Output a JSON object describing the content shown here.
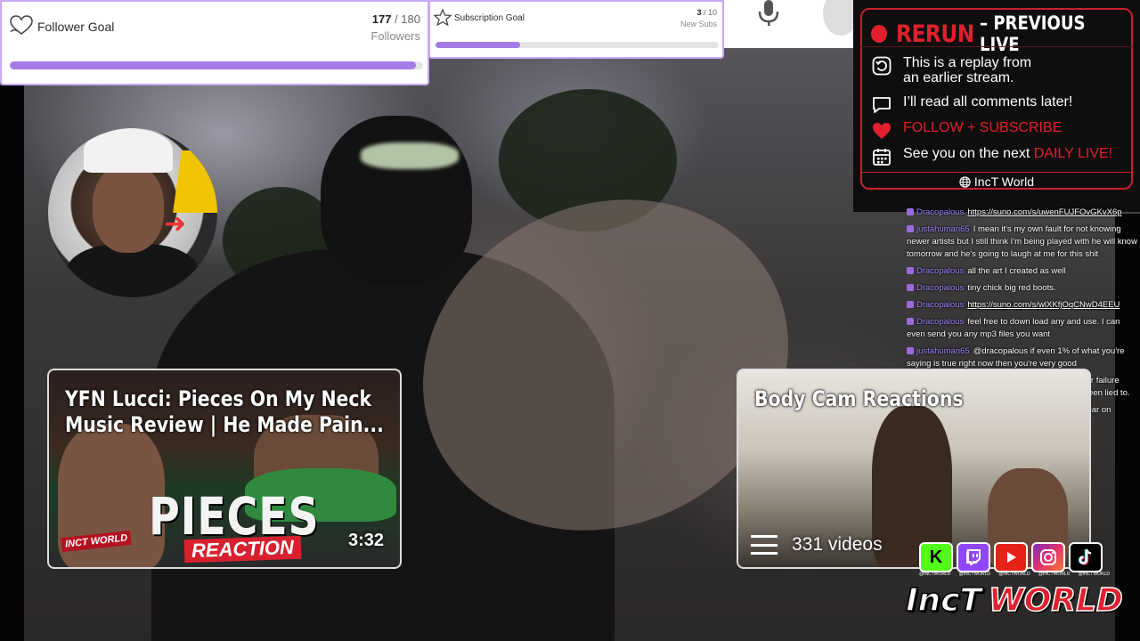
{
  "follower_goal": {
    "title": "Follower Goal",
    "current": "177",
    "separator": " / ",
    "target": "180",
    "unit": "Followers",
    "progress": 0.983
  },
  "subscription_goal": {
    "title": "Subscription Goal",
    "current": "3",
    "separator": " / ",
    "target": "10",
    "unit": "New Subs",
    "progress": 0.3
  },
  "rerun_panel": {
    "heading_red": "RERUN",
    "heading_white": "– PREVIOUS LIVE",
    "line1_a": "This is a replay from",
    "line1_b": "an earlier stream.",
    "line2": "I’ll read all comments later!",
    "line3": "FOLLOW + SUBSCRIBE",
    "line4_white": "See you on the next ",
    "line4_red": "DAILY LIVE!",
    "footer": "IncT World",
    "accent_color": "#e0202e"
  },
  "chat": [
    {
      "user": "Dracopalous",
      "text": "https://suno.com/s/uwenFUJFOvGKvX6p",
      "link": true
    },
    {
      "user": "justahuman65",
      "text": "I mean it's my own fault for not knowing newer artists but I still think I'm being played with he will know tomorrow and he's going to laugh at me for this shit",
      "link": false
    },
    {
      "user": "Dracopalous",
      "text": "all the art I created as well",
      "link": false
    },
    {
      "user": "Dracopalous",
      "text": "tiny chick big red boots.",
      "link": false
    },
    {
      "user": "Dracopalous",
      "text": "https://suno.com/s/wlXKfjOqCNwD4EEU",
      "link": true
    },
    {
      "user": "Dracopalous",
      "text": "feel free to down load any and use. I can even send you any mp3 files you want",
      "link": false
    },
    {
      "user": "justahuman65",
      "text": "@dracopalous if even 1% of what you're saying is true right now then you're very good",
      "link": false
    },
    {
      "user": "justahuman65",
      "text": "Oh man you're setting me up for failure tomorrow when I wake up and find out that I've been lied to.",
      "link": false
    },
    {
      "user": "Dracopalous",
      "text": "all originals in my spare time swear on",
      "link": false
    }
  ],
  "video_cards": {
    "left": {
      "title_line1": "YFN Lucci: Pieces On My Neck",
      "title_line2": "Music Review | He Made Pain...",
      "big_text": "PIECES",
      "banner_text": "REACTION",
      "duration": "3:32",
      "logo_text": "INCT WORLD"
    },
    "right": {
      "title": "Body Cam Reactions",
      "video_count": "331 videos"
    }
  },
  "socials": {
    "icons": [
      "kick-icon",
      "twitch-icon",
      "youtube-icon",
      "instagram-icon",
      "tiktok-icon"
    ],
    "handles": [
      "@INCTWORLD",
      "@INCTWORLD",
      "@INCTWORLD",
      "@INCTWORLD",
      "@INCTWORLD"
    ],
    "brand_word1": "IncT",
    "brand_word2": "WORLD"
  }
}
